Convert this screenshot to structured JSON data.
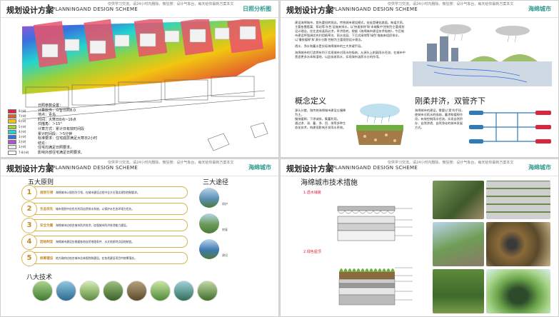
{
  "common": {
    "title": "规划设计方案",
    "subtitle": "PLANNINGAND DESIGN SCHEME",
    "note": "仅供学习交流。请24小时内删除。微信搜：设计气象台，每天给你最新方案本文"
  },
  "slide1": {
    "tag": "日照分析图",
    "params": [
      "日照参数设置：",
      "计算软件：众智日照8.0",
      "地点：青岛",
      "时间：大寒日8点~16点",
      "扫描角：＞15°",
      "计算方式：累计日有效时间段",
      "累计时间段：＞5分钟",
      "标准要求：住宅底层满足大寒日2小时",
      "结论：",
      "住宅均满足日照要求，",
      "影响外部住宅满足日照要求。"
    ],
    "legend": [
      {
        "label": "8小时",
        "color": "#d7263d"
      },
      {
        "label": "7小时",
        "color": "#e35d2d"
      },
      {
        "label": "6小时",
        "color": "#f2c511"
      },
      {
        "label": "5小时",
        "color": "#9ad13b"
      },
      {
        "label": "4小时",
        "color": "#22d4d0"
      },
      {
        "label": "3小时",
        "color": "#3a6fe0"
      },
      {
        "label": "2小时",
        "color": "#b24fd6"
      },
      {
        "label": "1小时",
        "color": "#e8e8e8"
      },
      {
        "label": "7-8小时",
        "color": "#ffffff"
      }
    ]
  },
  "slide2": {
    "tag": "海绵城市",
    "intro": [
      "建设海绵城市，首先要扭转观念。传统城市建设模式，处处是硬化路面。每逢大雨，主要依靠管渠、泵站等'灰色'设施来排水，以'快速排除'和'末端集中'控制为主要规划设计理念，往往造成逢雨必涝，旱涝急转。根据《海绵城市建设技术指南》，今后城市建设将强调优先利用植草沟、雨水花园、下沉式绿地等'绿色'措施来组织排水，以'慢排缓释'和'源头分散'控制为主要规划设计理念。",
      "透水、净水和蓄水是实现海绵城市的三大关键手段。",
      "海绵城市的打造将有利于实现城市对雨水的吸纳，从源头上削弱雨水径流，在城市中营造更多水体和湿地，以此吸收雨水，实现城市涵养水分的作用。"
    ],
    "concept_title": "概念定义",
    "concept_text": [
      "源头分散，指传统海绵城市建设以慢降为主。",
      "慢排缓释，下渗减排，集蓄利用。",
      "通过渗、滞、蓄、净、用、排等多种生态化技术，构建低影响开发雨水系统。"
    ],
    "rigid_title": "刚柔并济，双管齐下",
    "rigid_text": [
      "海绵城市的建设，需要以'柔'的手段，使城市对雨水的吸纳、蓄渗和缓释作用，有效控制雨水径流，实现自然积存、自然渗透、自然净化的城市发展方式。"
    ]
  },
  "slide3": {
    "tag": "海绵城市",
    "principles_title": "五大原则",
    "paths_title": "三大途径",
    "tech_title": "八大技术",
    "principles": [
      {
        "n": "1",
        "name": "规划引领",
        "text": "海绵城市以规划为引领，在城市建设过程中全方位落实规划控制要求。"
      },
      {
        "n": "2",
        "name": "生态优先",
        "text": "城市规划中应优先利用自然排水系统，以保护水生态环境为优先。"
      },
      {
        "n": "3",
        "name": "安全为重",
        "text": "海绵城市应结合城市防洪排涝，加强城市防洪排涝能力建设。"
      },
      {
        "n": "4",
        "name": "因地制宜",
        "text": "海绵城市建设应根据各地自然地理条件、水文地质特点因地制宜。"
      },
      {
        "n": "5",
        "name": "统筹建设",
        "text": "地方政府应结合城市总体规划和建设，在各类建设项目中统筹落实。"
      }
    ],
    "paths": [
      "保护",
      "修复",
      "建设"
    ]
  },
  "slide4": {
    "tag": "海绵城市",
    "heading": "海绵城市技术措施",
    "section1": "1.透水铺装",
    "section2": "2.绿色屋顶"
  }
}
